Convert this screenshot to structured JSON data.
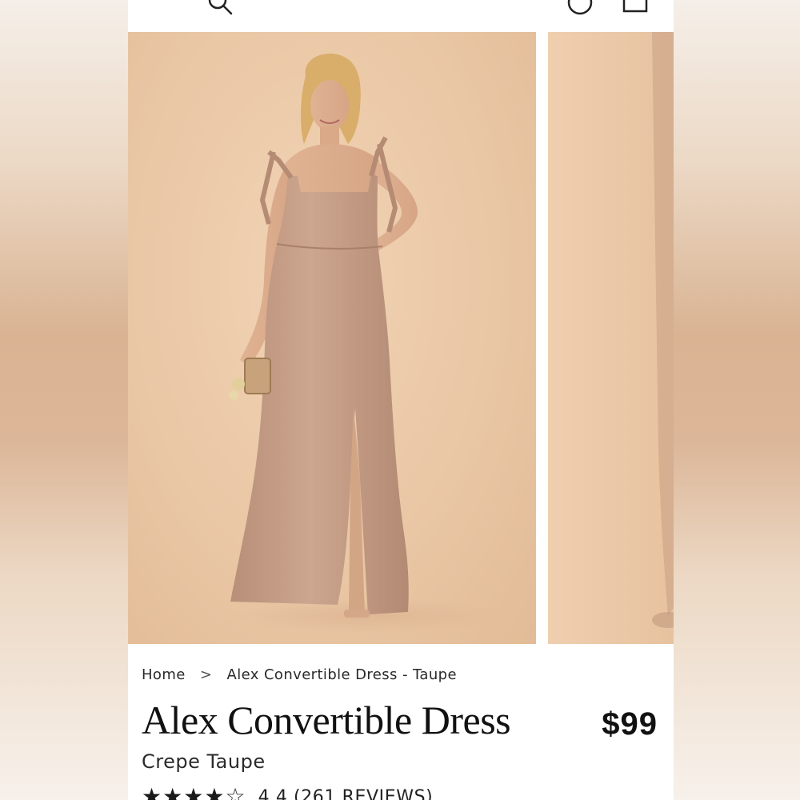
{
  "breadcrumb": {
    "home": "Home",
    "separator": ">",
    "current": "Alex Convertible Dress - Taupe"
  },
  "product": {
    "title": "Alex Convertible Dress",
    "price": "$99",
    "variant": "Crepe Taupe",
    "rating_value": 4.4,
    "rating_text": "4.4 (261 REVIEWS)"
  },
  "gallery": {
    "images": [
      {
        "alt": "model-wearing-dress-front"
      },
      {
        "alt": "next-product-image"
      }
    ]
  },
  "icons": {
    "search": "search-icon",
    "account": "account-icon",
    "bag": "bag-icon"
  },
  "colors": {
    "backdrop": "#ebc8a6",
    "dress": "#c9a18a",
    "text": "#111111"
  }
}
